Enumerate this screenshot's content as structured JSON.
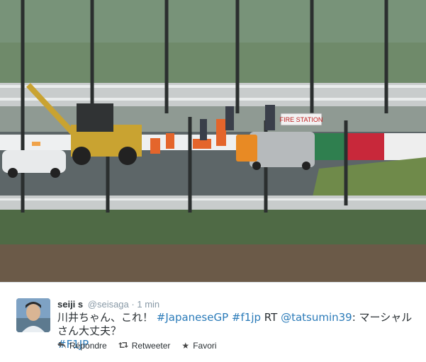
{
  "photo": {
    "sign_text": "FIRE STATION"
  },
  "tweet": {
    "author_name": "seiji s",
    "author_handle": "@seisaga",
    "separator": "·",
    "time": "1 min",
    "text_1": "川井ちゃん、これ！ ",
    "hashtag_1": "#JapaneseGP",
    "hashtag_2": "#f1jp",
    "rt": "RT",
    "mention": "@tatsumin39",
    "text_2": ": マーシャルさん大丈夫？",
    "hashtag_3": "#F1JP"
  },
  "actions": {
    "reply_label": "Répondre",
    "reply_icon": "reply-icon",
    "retweet_label": "Retweeter",
    "retweet_icon": "retweet-icon",
    "favorite_label": "Favori",
    "favorite_icon": "star-icon"
  },
  "colors": {
    "link": "#2b7bb9",
    "text": "#292f33",
    "muted": "#8899a6"
  }
}
